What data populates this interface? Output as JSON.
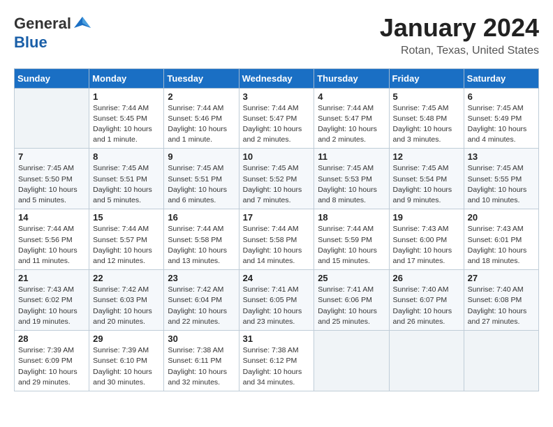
{
  "logo": {
    "general": "General",
    "blue": "Blue"
  },
  "title": "January 2024",
  "location": "Rotan, Texas, United States",
  "days_header": [
    "Sunday",
    "Monday",
    "Tuesday",
    "Wednesday",
    "Thursday",
    "Friday",
    "Saturday"
  ],
  "weeks": [
    [
      {
        "day": "",
        "info": ""
      },
      {
        "day": "1",
        "info": "Sunrise: 7:44 AM\nSunset: 5:45 PM\nDaylight: 10 hours\nand 1 minute."
      },
      {
        "day": "2",
        "info": "Sunrise: 7:44 AM\nSunset: 5:46 PM\nDaylight: 10 hours\nand 1 minute."
      },
      {
        "day": "3",
        "info": "Sunrise: 7:44 AM\nSunset: 5:47 PM\nDaylight: 10 hours\nand 2 minutes."
      },
      {
        "day": "4",
        "info": "Sunrise: 7:44 AM\nSunset: 5:47 PM\nDaylight: 10 hours\nand 2 minutes."
      },
      {
        "day": "5",
        "info": "Sunrise: 7:45 AM\nSunset: 5:48 PM\nDaylight: 10 hours\nand 3 minutes."
      },
      {
        "day": "6",
        "info": "Sunrise: 7:45 AM\nSunset: 5:49 PM\nDaylight: 10 hours\nand 4 minutes."
      }
    ],
    [
      {
        "day": "7",
        "info": "Sunrise: 7:45 AM\nSunset: 5:50 PM\nDaylight: 10 hours\nand 5 minutes."
      },
      {
        "day": "8",
        "info": "Sunrise: 7:45 AM\nSunset: 5:51 PM\nDaylight: 10 hours\nand 5 minutes."
      },
      {
        "day": "9",
        "info": "Sunrise: 7:45 AM\nSunset: 5:51 PM\nDaylight: 10 hours\nand 6 minutes."
      },
      {
        "day": "10",
        "info": "Sunrise: 7:45 AM\nSunset: 5:52 PM\nDaylight: 10 hours\nand 7 minutes."
      },
      {
        "day": "11",
        "info": "Sunrise: 7:45 AM\nSunset: 5:53 PM\nDaylight: 10 hours\nand 8 minutes."
      },
      {
        "day": "12",
        "info": "Sunrise: 7:45 AM\nSunset: 5:54 PM\nDaylight: 10 hours\nand 9 minutes."
      },
      {
        "day": "13",
        "info": "Sunrise: 7:45 AM\nSunset: 5:55 PM\nDaylight: 10 hours\nand 10 minutes."
      }
    ],
    [
      {
        "day": "14",
        "info": "Sunrise: 7:44 AM\nSunset: 5:56 PM\nDaylight: 10 hours\nand 11 minutes."
      },
      {
        "day": "15",
        "info": "Sunrise: 7:44 AM\nSunset: 5:57 PM\nDaylight: 10 hours\nand 12 minutes."
      },
      {
        "day": "16",
        "info": "Sunrise: 7:44 AM\nSunset: 5:58 PM\nDaylight: 10 hours\nand 13 minutes."
      },
      {
        "day": "17",
        "info": "Sunrise: 7:44 AM\nSunset: 5:58 PM\nDaylight: 10 hours\nand 14 minutes."
      },
      {
        "day": "18",
        "info": "Sunrise: 7:44 AM\nSunset: 5:59 PM\nDaylight: 10 hours\nand 15 minutes."
      },
      {
        "day": "19",
        "info": "Sunrise: 7:43 AM\nSunset: 6:00 PM\nDaylight: 10 hours\nand 17 minutes."
      },
      {
        "day": "20",
        "info": "Sunrise: 7:43 AM\nSunset: 6:01 PM\nDaylight: 10 hours\nand 18 minutes."
      }
    ],
    [
      {
        "day": "21",
        "info": "Sunrise: 7:43 AM\nSunset: 6:02 PM\nDaylight: 10 hours\nand 19 minutes."
      },
      {
        "day": "22",
        "info": "Sunrise: 7:42 AM\nSunset: 6:03 PM\nDaylight: 10 hours\nand 20 minutes."
      },
      {
        "day": "23",
        "info": "Sunrise: 7:42 AM\nSunset: 6:04 PM\nDaylight: 10 hours\nand 22 minutes."
      },
      {
        "day": "24",
        "info": "Sunrise: 7:41 AM\nSunset: 6:05 PM\nDaylight: 10 hours\nand 23 minutes."
      },
      {
        "day": "25",
        "info": "Sunrise: 7:41 AM\nSunset: 6:06 PM\nDaylight: 10 hours\nand 25 minutes."
      },
      {
        "day": "26",
        "info": "Sunrise: 7:40 AM\nSunset: 6:07 PM\nDaylight: 10 hours\nand 26 minutes."
      },
      {
        "day": "27",
        "info": "Sunrise: 7:40 AM\nSunset: 6:08 PM\nDaylight: 10 hours\nand 27 minutes."
      }
    ],
    [
      {
        "day": "28",
        "info": "Sunrise: 7:39 AM\nSunset: 6:09 PM\nDaylight: 10 hours\nand 29 minutes."
      },
      {
        "day": "29",
        "info": "Sunrise: 7:39 AM\nSunset: 6:10 PM\nDaylight: 10 hours\nand 30 minutes."
      },
      {
        "day": "30",
        "info": "Sunrise: 7:38 AM\nSunset: 6:11 PM\nDaylight: 10 hours\nand 32 minutes."
      },
      {
        "day": "31",
        "info": "Sunrise: 7:38 AM\nSunset: 6:12 PM\nDaylight: 10 hours\nand 34 minutes."
      },
      {
        "day": "",
        "info": ""
      },
      {
        "day": "",
        "info": ""
      },
      {
        "day": "",
        "info": ""
      }
    ]
  ]
}
